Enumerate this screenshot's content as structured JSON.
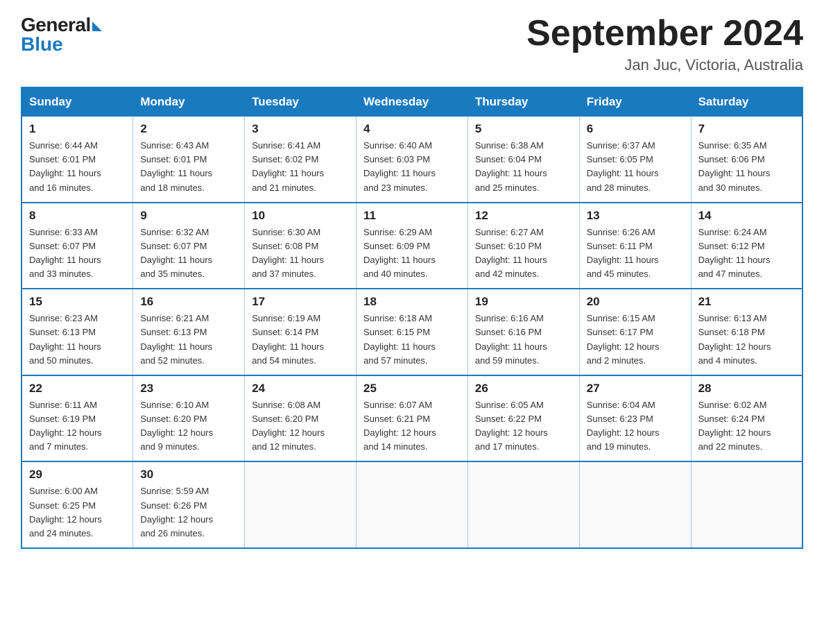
{
  "header": {
    "logo_general": "General",
    "logo_blue": "Blue",
    "month_title": "September 2024",
    "location": "Jan Juc, Victoria, Australia"
  },
  "days_of_week": [
    "Sunday",
    "Monday",
    "Tuesday",
    "Wednesday",
    "Thursday",
    "Friday",
    "Saturday"
  ],
  "weeks": [
    [
      {
        "day": "1",
        "sunrise": "6:44 AM",
        "sunset": "6:01 PM",
        "daylight": "11 hours and 16 minutes."
      },
      {
        "day": "2",
        "sunrise": "6:43 AM",
        "sunset": "6:01 PM",
        "daylight": "11 hours and 18 minutes."
      },
      {
        "day": "3",
        "sunrise": "6:41 AM",
        "sunset": "6:02 PM",
        "daylight": "11 hours and 21 minutes."
      },
      {
        "day": "4",
        "sunrise": "6:40 AM",
        "sunset": "6:03 PM",
        "daylight": "11 hours and 23 minutes."
      },
      {
        "day": "5",
        "sunrise": "6:38 AM",
        "sunset": "6:04 PM",
        "daylight": "11 hours and 25 minutes."
      },
      {
        "day": "6",
        "sunrise": "6:37 AM",
        "sunset": "6:05 PM",
        "daylight": "11 hours and 28 minutes."
      },
      {
        "day": "7",
        "sunrise": "6:35 AM",
        "sunset": "6:06 PM",
        "daylight": "11 hours and 30 minutes."
      }
    ],
    [
      {
        "day": "8",
        "sunrise": "6:33 AM",
        "sunset": "6:07 PM",
        "daylight": "11 hours and 33 minutes."
      },
      {
        "day": "9",
        "sunrise": "6:32 AM",
        "sunset": "6:07 PM",
        "daylight": "11 hours and 35 minutes."
      },
      {
        "day": "10",
        "sunrise": "6:30 AM",
        "sunset": "6:08 PM",
        "daylight": "11 hours and 37 minutes."
      },
      {
        "day": "11",
        "sunrise": "6:29 AM",
        "sunset": "6:09 PM",
        "daylight": "11 hours and 40 minutes."
      },
      {
        "day": "12",
        "sunrise": "6:27 AM",
        "sunset": "6:10 PM",
        "daylight": "11 hours and 42 minutes."
      },
      {
        "day": "13",
        "sunrise": "6:26 AM",
        "sunset": "6:11 PM",
        "daylight": "11 hours and 45 minutes."
      },
      {
        "day": "14",
        "sunrise": "6:24 AM",
        "sunset": "6:12 PM",
        "daylight": "11 hours and 47 minutes."
      }
    ],
    [
      {
        "day": "15",
        "sunrise": "6:23 AM",
        "sunset": "6:13 PM",
        "daylight": "11 hours and 50 minutes."
      },
      {
        "day": "16",
        "sunrise": "6:21 AM",
        "sunset": "6:13 PM",
        "daylight": "11 hours and 52 minutes."
      },
      {
        "day": "17",
        "sunrise": "6:19 AM",
        "sunset": "6:14 PM",
        "daylight": "11 hours and 54 minutes."
      },
      {
        "day": "18",
        "sunrise": "6:18 AM",
        "sunset": "6:15 PM",
        "daylight": "11 hours and 57 minutes."
      },
      {
        "day": "19",
        "sunrise": "6:16 AM",
        "sunset": "6:16 PM",
        "daylight": "11 hours and 59 minutes."
      },
      {
        "day": "20",
        "sunrise": "6:15 AM",
        "sunset": "6:17 PM",
        "daylight": "12 hours and 2 minutes."
      },
      {
        "day": "21",
        "sunrise": "6:13 AM",
        "sunset": "6:18 PM",
        "daylight": "12 hours and 4 minutes."
      }
    ],
    [
      {
        "day": "22",
        "sunrise": "6:11 AM",
        "sunset": "6:19 PM",
        "daylight": "12 hours and 7 minutes."
      },
      {
        "day": "23",
        "sunrise": "6:10 AM",
        "sunset": "6:20 PM",
        "daylight": "12 hours and 9 minutes."
      },
      {
        "day": "24",
        "sunrise": "6:08 AM",
        "sunset": "6:20 PM",
        "daylight": "12 hours and 12 minutes."
      },
      {
        "day": "25",
        "sunrise": "6:07 AM",
        "sunset": "6:21 PM",
        "daylight": "12 hours and 14 minutes."
      },
      {
        "day": "26",
        "sunrise": "6:05 AM",
        "sunset": "6:22 PM",
        "daylight": "12 hours and 17 minutes."
      },
      {
        "day": "27",
        "sunrise": "6:04 AM",
        "sunset": "6:23 PM",
        "daylight": "12 hours and 19 minutes."
      },
      {
        "day": "28",
        "sunrise": "6:02 AM",
        "sunset": "6:24 PM",
        "daylight": "12 hours and 22 minutes."
      }
    ],
    [
      {
        "day": "29",
        "sunrise": "6:00 AM",
        "sunset": "6:25 PM",
        "daylight": "12 hours and 24 minutes."
      },
      {
        "day": "30",
        "sunrise": "5:59 AM",
        "sunset": "6:26 PM",
        "daylight": "12 hours and 26 minutes."
      },
      null,
      null,
      null,
      null,
      null
    ]
  ],
  "labels": {
    "sunrise": "Sunrise:",
    "sunset": "Sunset:",
    "daylight": "Daylight:"
  }
}
